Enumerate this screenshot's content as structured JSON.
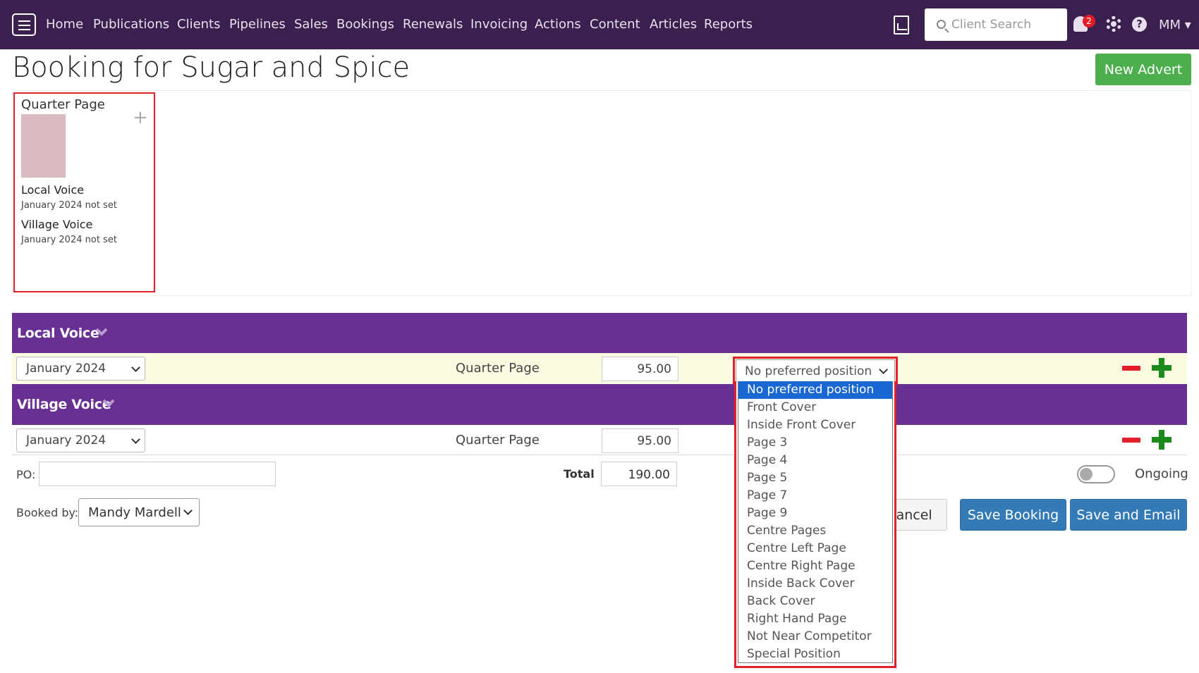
{
  "nav": {
    "items": [
      "Home",
      "Publications",
      "Clients",
      "Pipelines",
      "Sales",
      "Bookings",
      "Renewals",
      "Invoicing",
      "Actions",
      "Content",
      "Articles",
      "Reports"
    ],
    "search_placeholder": "Client Search",
    "notification_count": "2",
    "help_label": "?",
    "user_label": "MM ▾"
  },
  "page": {
    "title": "Booking for Sugar and Spice",
    "new_advert_label": "New Advert"
  },
  "ad_card": {
    "title": "Quarter Page",
    "publications": [
      {
        "name": "Local Voice",
        "status": "January 2024 not set"
      },
      {
        "name": "Village Voice",
        "status": "January 2024 not set"
      }
    ]
  },
  "sections": [
    {
      "publication": "Local Voice",
      "month": "January 2024",
      "size": "Quarter Page",
      "price": "95.00",
      "position": "No preferred position"
    },
    {
      "publication": "Village Voice",
      "month": "January 2024",
      "size": "Quarter Page",
      "price": "95.00"
    }
  ],
  "position_options": [
    "No preferred position",
    "Front Cover",
    "Inside Front Cover",
    "Page 3",
    "Page 4",
    "Page 5",
    "Page 7",
    "Page 9",
    "Centre Pages",
    "Centre Left Page",
    "Centre Right Page",
    "Inside Back Cover",
    "Back Cover",
    "Right Hand Page",
    "Not Near Competitor",
    "Special Position"
  ],
  "footer": {
    "po_label": "PO:",
    "total_label": "Total",
    "total_value": "190.00",
    "ongoing_label": "Ongoing",
    "booked_by_label": "Booked by:",
    "booked_by_value": "Mandy Mardell",
    "cancel_label": "Cancel",
    "save_label": "Save Booking",
    "save_email_label": "Save and Email"
  },
  "colors": {
    "nav_bg": "#3b1f4f",
    "section_header": "#673092",
    "accent_green": "#4cae4c",
    "primary_blue": "#337ab7",
    "highlight_red": "#e0202a"
  }
}
